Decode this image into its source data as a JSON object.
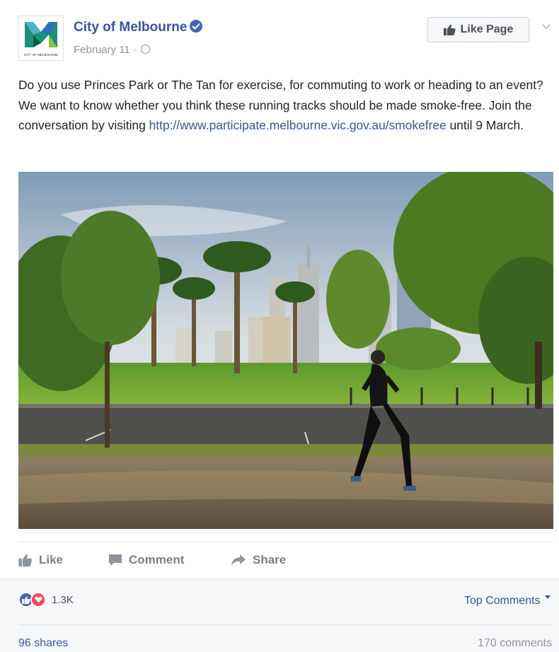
{
  "post": {
    "page_name": "City of Melbourne",
    "date": "February 11",
    "meta_separator": " · ",
    "logo_caption": "CITY OF MELBOURNE",
    "like_page_label": "Like Page",
    "text_part1": "Do you use Princes Park or The Tan for exercise, for commuting to work or heading to an event? We want to know whether you think these running tracks should be made smoke-free. Join the conversation by visiting ",
    "link_text": "http://www.participate.melbourne.vic.gov.au/smokefree",
    "text_part2": " until 9 March."
  },
  "actions": {
    "like": "Like",
    "comment": "Comment",
    "share": "Share"
  },
  "stats": {
    "reaction_count": "1.3K",
    "top_comments": "Top Comments",
    "shares": "96 shares",
    "comments": "170 comments"
  },
  "icons": {
    "verified": "verified-badge-icon",
    "globe": "globe-icon",
    "like": "thumbs-up-icon",
    "comment": "comment-bubble-icon",
    "share": "share-arrow-icon",
    "love": "heart-icon"
  },
  "colors": {
    "link": "#365899",
    "brand_blue": "#4267b2",
    "love_red": "#ed4956",
    "muted": "#90949c"
  }
}
